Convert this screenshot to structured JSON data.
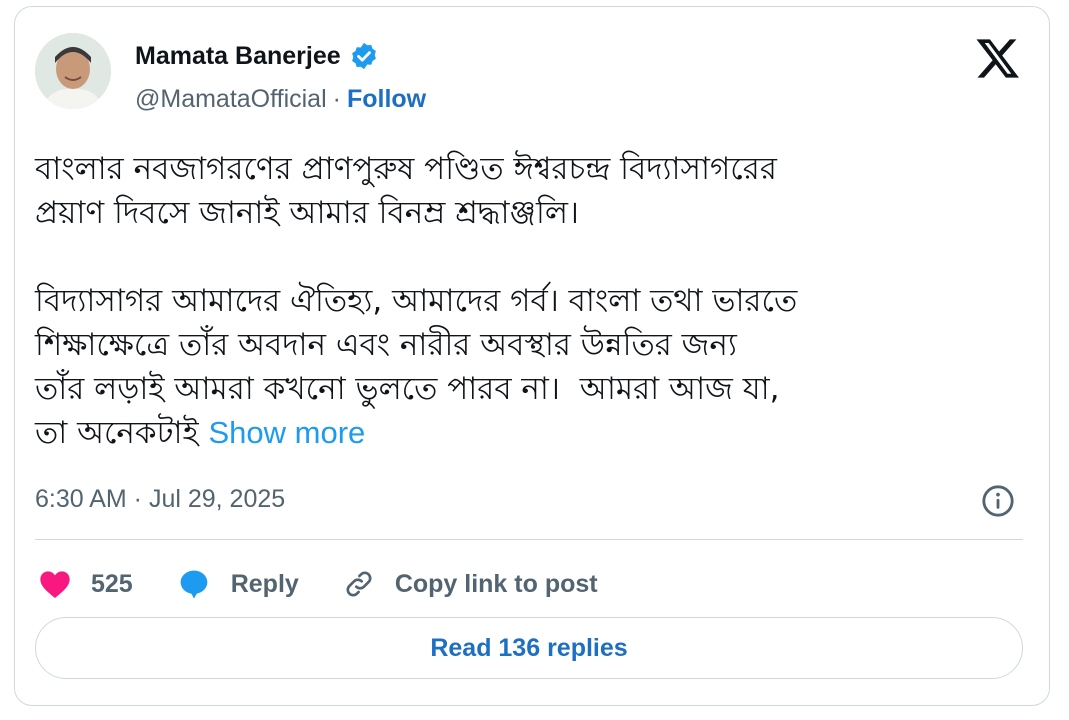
{
  "author": {
    "name": "Mamata Banerjee",
    "handle": "@MamataOfficial",
    "separator": "·",
    "follow_label": "Follow",
    "avatar": "profile-photo",
    "verified_icon": "verified-badge-icon"
  },
  "platform_icon": "x-logo-icon",
  "tweet": {
    "paragraph1": "বাংলার নবজাগরণের প্রাণপুরুষ পণ্ডিত ঈশ্বরচন্দ্র বিদ্যাসাগরের\nপ্রয়াণ দিবসে জানাই আমার বিনম্র শ্রদ্ধাঞ্জলি।",
    "paragraph2": "বিদ্যাসাগর আমাদের ঐতিহ্য, আমাদের গর্ব। বাংলা তথা ভারতে\nশিক্ষাক্ষেত্রে তাঁর অবদান এবং নারীর অবস্থার উন্নতির জন্য\nতাঁর লড়াই আমরা কখনো ভুলতে পারব না।  আমরা আজ যা,\nতা অনেকটাই ",
    "show_more_label": "Show more"
  },
  "timestamp": "6:30 AM · Jul 29, 2025",
  "actions": {
    "like_count": "525",
    "reply_label": "Reply",
    "copy_link_label": "Copy link to post"
  },
  "read_replies_label": "Read 136 replies",
  "colors": {
    "accent": "#1d9bf0",
    "link": "#1d6fc4",
    "like": "#f91880",
    "muted": "#536471",
    "border": "#cfd9de"
  }
}
